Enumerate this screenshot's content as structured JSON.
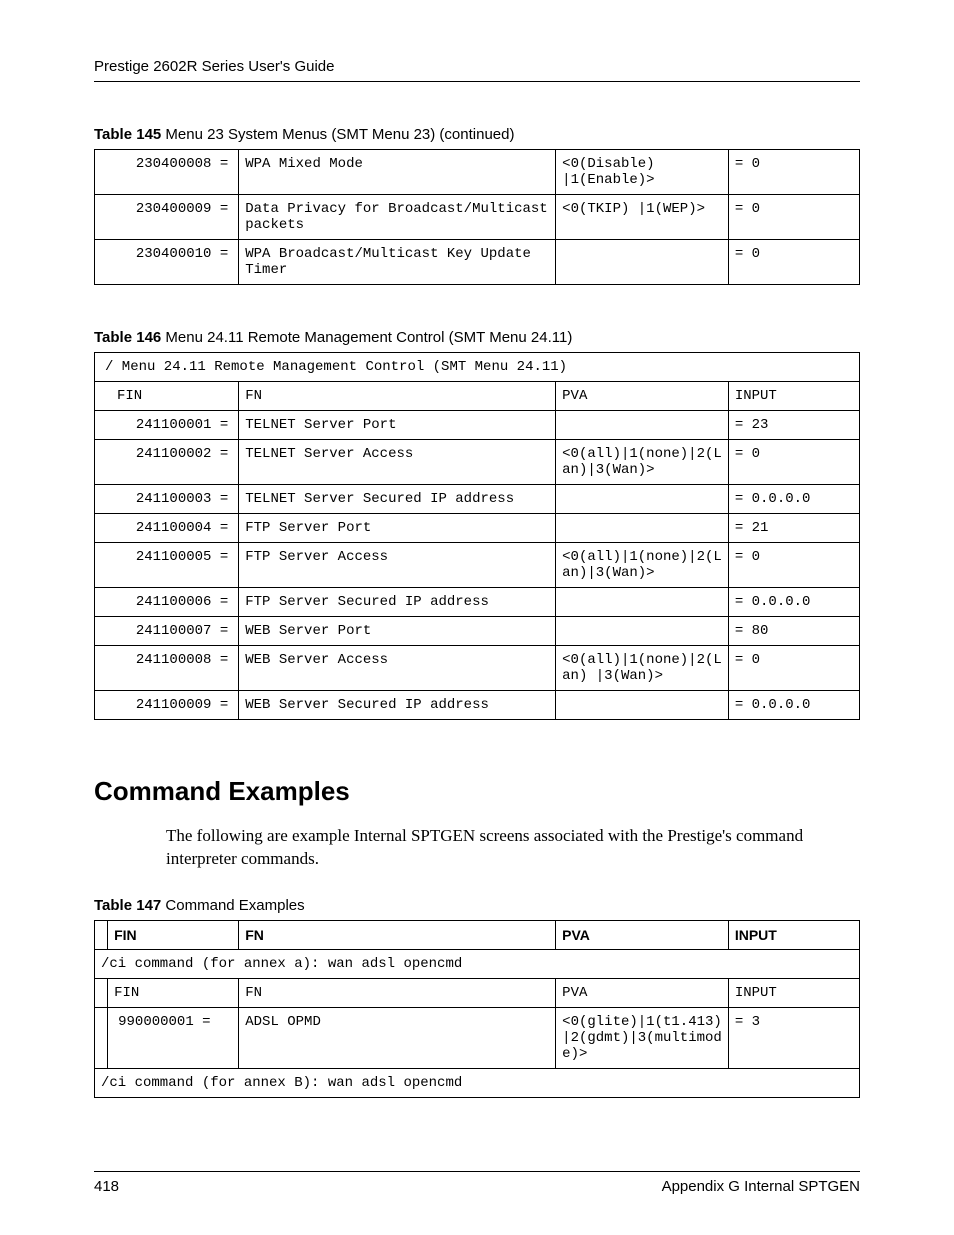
{
  "header": {
    "running": "Prestige 2602R Series User's Guide"
  },
  "table145": {
    "caption_bold": "Table 145",
    "caption_rest": "   Menu 23 System Menus (SMT Menu 23) (continued)",
    "rows": [
      {
        "fin": "230400008 =",
        "fn": "WPA Mixed Mode",
        "pva": "<0(Disable) |1(Enable)>",
        "input": "= 0"
      },
      {
        "fin": "230400009 =",
        "fn": "Data Privacy for Broadcast/Multicast packets",
        "pva": "<0(TKIP) |1(WEP)>",
        "input": "= 0"
      },
      {
        "fin": "230400010 =",
        "fn": "WPA Broadcast/Multicast Key Update Timer",
        "pva": "",
        "input": "= 0"
      }
    ]
  },
  "table146": {
    "caption_bold": "Table 146",
    "caption_rest": "   Menu 24.11 Remote Management Control (SMT Menu 24.11)",
    "banner": "/ Menu 24.11 Remote Management Control (SMT Menu 24.11)",
    "head": {
      "fin": "FIN",
      "fn": "FN",
      "pva": "PVA",
      "input": "INPUT"
    },
    "rows": [
      {
        "fin": "241100001 =",
        "fn": "TELNET Server Port",
        "pva": "",
        "input": "= 23"
      },
      {
        "fin": "241100002 =",
        "fn": "TELNET Server Access",
        "pva": "<0(all)|1(none)|2(Lan)|3(Wan)>",
        "input": "= 0"
      },
      {
        "fin": "241100003 =",
        "fn": "TELNET Server Secured IP address",
        "pva": "",
        "input": "= 0.0.0.0"
      },
      {
        "fin": "241100004 =",
        "fn": "FTP Server Port",
        "pva": "",
        "input": "= 21"
      },
      {
        "fin": "241100005 =",
        "fn": "FTP Server Access",
        "pva": "<0(all)|1(none)|2(Lan)|3(Wan)>",
        "input": "= 0"
      },
      {
        "fin": "241100006 =",
        "fn": "FTP Server Secured IP address",
        "pva": "",
        "input": "= 0.0.0.0"
      },
      {
        "fin": "241100007 =",
        "fn": "WEB Server Port",
        "pva": "",
        "input": "= 80"
      },
      {
        "fin": "241100008 =",
        "fn": "WEB Server Access",
        "pva": "<0(all)|1(none)|2(Lan) |3(Wan)>",
        "input": "= 0"
      },
      {
        "fin": "241100009 =",
        "fn": "WEB Server Secured IP address",
        "pva": "",
        "input": "= 0.0.0.0"
      }
    ]
  },
  "section": {
    "title": "Command Examples",
    "para": "The following are example Internal SPTGEN screens associated with the Prestige's command interpreter commands."
  },
  "table147": {
    "caption_bold": "Table 147",
    "caption_rest": "   Command Examples",
    "head": {
      "fin": "FIN",
      "fn": "FN",
      "pva": "PVA",
      "input": "INPUT"
    },
    "banner1": "/ci command (for annex a): wan adsl opencmd",
    "sub": {
      "fin": "FIN",
      "fn": "FN",
      "pva": "PVA",
      "input": "INPUT"
    },
    "row": {
      "fin": "990000001 =",
      "fn": "ADSL OPMD",
      "pva": "<0(glite)|1(t1.413)|2(gdmt)|3(multimode)>",
      "input": "= 3"
    },
    "banner2": "/ci command (for annex B): wan adsl opencmd"
  },
  "footer": {
    "page": "418",
    "section": "Appendix G Internal SPTGEN"
  }
}
